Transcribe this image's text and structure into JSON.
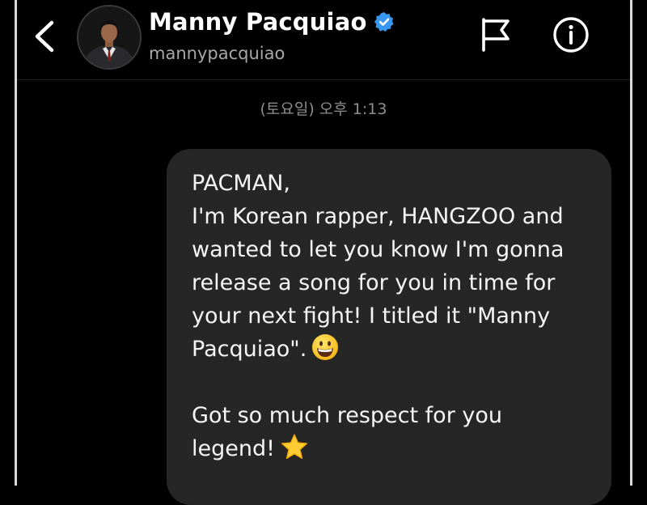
{
  "header": {
    "back_icon": "chevron-left-icon",
    "avatar_icon": "profile-photo",
    "name": "Manny Pacquiao",
    "verified_icon": "verified-badge-icon",
    "handle": "mannypacquiao",
    "flag_icon": "flag-icon",
    "info_icon": "info-icon"
  },
  "conversation": {
    "timestamp": "(토요일) 오후 1:13",
    "message": {
      "line1": "PACMAN,",
      "line2": "I'm Korean rapper, HANGZOO and",
      "line3": "wanted to let you know I'm gonna",
      "line4": "release a song for you in time for",
      "line5": "your next fight! I titled it \"Manny",
      "line6": "Pacquiao\".",
      "line6_emoji": "grinning-face-emoji",
      "line8": "Got so much respect for you",
      "line9": "legend!",
      "line9_emoji": "star-emoji"
    }
  },
  "colors": {
    "background": "#000000",
    "bubble": "#262626",
    "verified": "#3897f0",
    "secondary_text": "#a8a8a8"
  }
}
